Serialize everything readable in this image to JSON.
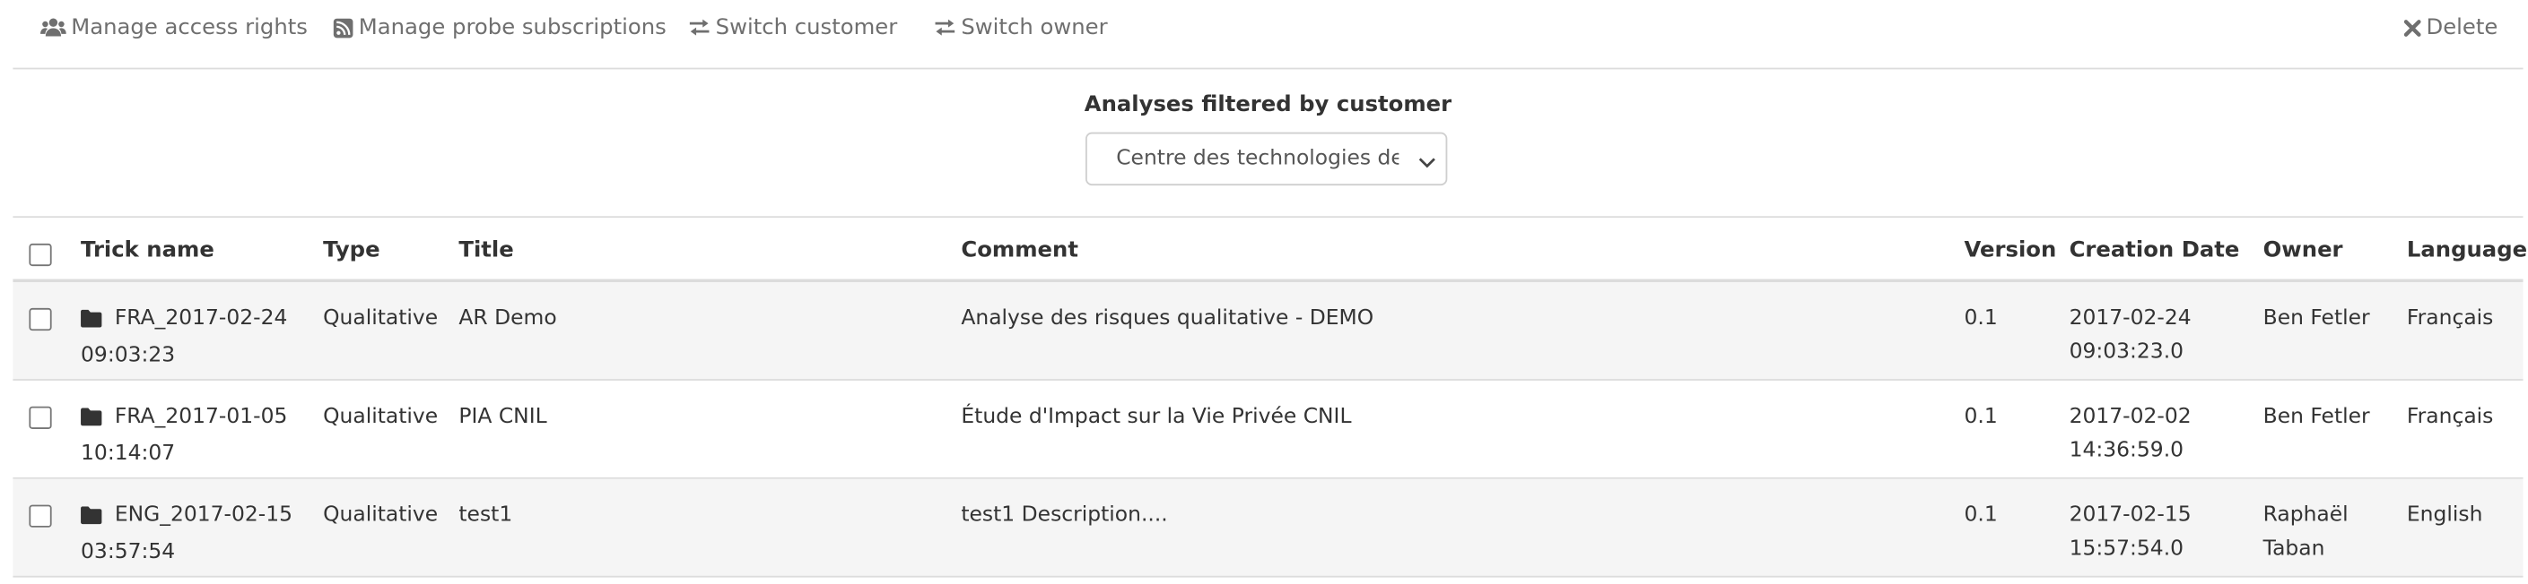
{
  "toolbar": {
    "access": {
      "label": "Manage access rights",
      "icon": "users-icon"
    },
    "probe": {
      "label": "Manage probe subscriptions",
      "icon": "rss-icon"
    },
    "customer": {
      "label": "Switch customer",
      "icon": "exchange-icon"
    },
    "owner": {
      "label": "Switch owner",
      "icon": "exchange-icon"
    },
    "delete": {
      "label": "Delete",
      "icon": "times-icon"
    }
  },
  "filter": {
    "title": "Analyses filtered by customer",
    "selected": "Centre des technologies de l'i"
  },
  "table": {
    "headers": {
      "trick_name": "Trick name",
      "type": "Type",
      "title": "Title",
      "comment": "Comment",
      "version": "Version",
      "creation_date": "Creation Date",
      "owner": "Owner",
      "language": "Language"
    },
    "rows": [
      {
        "trick_name_a": "FRA_2017-02-24",
        "trick_name_b": "09:03:23",
        "type": "Qualitative",
        "title": "AR Demo",
        "comment": "Analyse des risques qualitative - DEMO",
        "version": "0.1",
        "date_a": "2017-02-24",
        "date_b": "09:03:23.0",
        "owner_a": "Ben Fetler",
        "owner_b": "",
        "language": "Français"
      },
      {
        "trick_name_a": "FRA_2017-01-05",
        "trick_name_b": "10:14:07",
        "type": "Qualitative",
        "title": "PIA CNIL",
        "comment": "Étude d'Impact sur la Vie Privée CNIL",
        "version": "0.1",
        "date_a": "2017-02-02",
        "date_b": "14:36:59.0",
        "owner_a": "Ben Fetler",
        "owner_b": "",
        "language": "Français"
      },
      {
        "trick_name_a": "ENG_2017-02-15",
        "trick_name_b": "03:57:54",
        "type": "Qualitative",
        "title": "test1",
        "comment": "test1 Description....",
        "version": "0.1",
        "date_a": "2017-02-15",
        "date_b": "15:57:54.0",
        "owner_a": "Raphaël",
        "owner_b": "Taban",
        "language": "English"
      }
    ]
  }
}
